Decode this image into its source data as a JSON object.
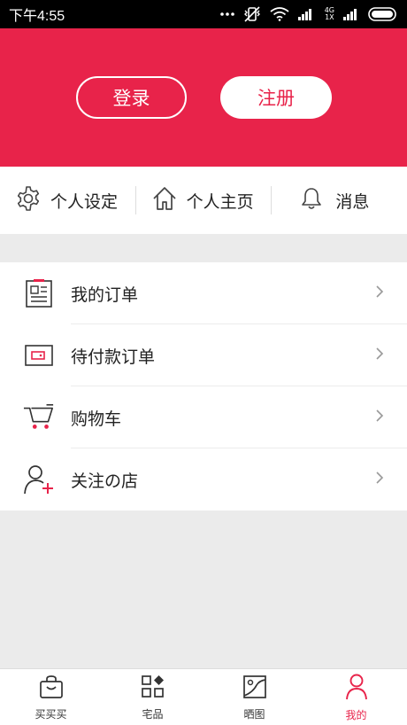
{
  "status_bar": {
    "time": "下午4:55",
    "network_top": "4G",
    "network_bottom": "1X"
  },
  "header": {
    "login_label": "登录",
    "register_label": "注册",
    "accent": "#e8234a"
  },
  "quick_bar": {
    "items": [
      {
        "label": "个人设定",
        "icon": "gear-icon"
      },
      {
        "label": "个人主页",
        "icon": "home-icon"
      },
      {
        "label": "消息",
        "icon": "bell-icon"
      }
    ]
  },
  "menu": {
    "items": [
      {
        "label": "我的订单",
        "icon": "order-list-icon"
      },
      {
        "label": "待付款订单",
        "icon": "wallet-icon"
      },
      {
        "label": "购物车",
        "icon": "cart-icon"
      },
      {
        "label": "关注の店",
        "icon": "follow-user-icon"
      }
    ]
  },
  "bottom_nav": {
    "items": [
      {
        "label": "买买买",
        "icon": "shopping-bag-icon"
      },
      {
        "label": "宅品",
        "icon": "grid-icon"
      },
      {
        "label": "晒图",
        "icon": "photo-icon"
      },
      {
        "label": "我的",
        "icon": "person-icon",
        "active": true
      }
    ]
  }
}
